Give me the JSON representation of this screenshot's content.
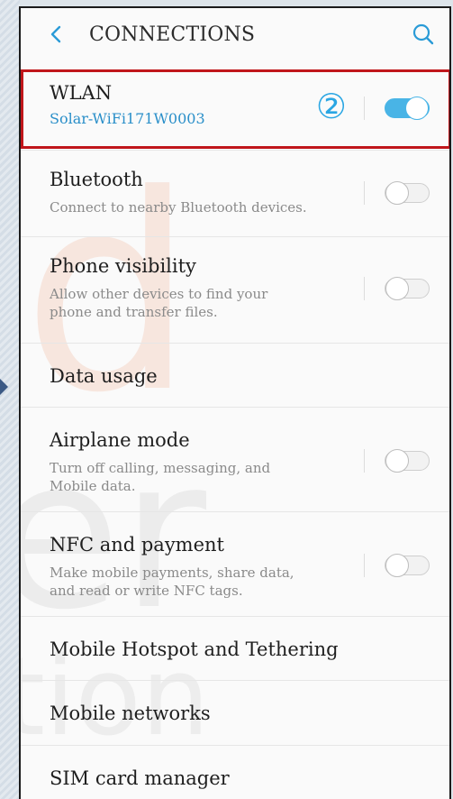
{
  "header": {
    "title": "CONNECTIONS",
    "back_icon": "chevron-left-icon",
    "search_icon": "search-icon"
  },
  "annotation": {
    "marker": "②"
  },
  "items": [
    {
      "label": "WLAN",
      "sub": "Solar-WiFi171W0003",
      "toggle": true
    },
    {
      "label": "Bluetooth",
      "desc": "Connect to nearby Bluetooth devices.",
      "toggle": false
    },
    {
      "label": "Phone visibility",
      "desc": "Allow other devices to find your phone and transfer files.",
      "toggle": false
    },
    {
      "label": "Data usage"
    },
    {
      "label": "Airplane mode",
      "desc": "Turn off calling, messaging, and Mobile data.",
      "toggle": false
    },
    {
      "label": "NFC and payment",
      "desc": "Make mobile payments, share data, and read or write NFC tags.",
      "toggle": false
    },
    {
      "label": "Mobile Hotspot and Tethering"
    },
    {
      "label": "Mobile networks"
    },
    {
      "label": "SIM card manager"
    }
  ],
  "colors": {
    "accent": "#49b4e6",
    "subtext": "#2a8fc9",
    "callout": "#c0161b"
  }
}
